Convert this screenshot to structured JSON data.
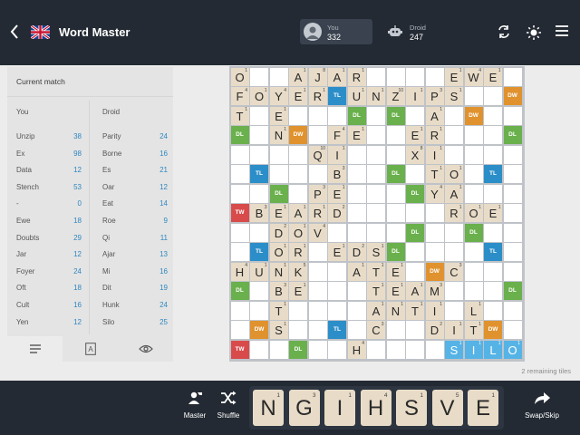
{
  "header": {
    "title": "Word Master",
    "you": {
      "name": "You",
      "score": "332"
    },
    "droid": {
      "name": "Droid",
      "score": "247"
    },
    "icons": [
      "back-icon",
      "uk-flag-icon",
      "swap-icon",
      "brightness-icon",
      "menu-icon"
    ]
  },
  "panel": {
    "title": "Current match",
    "col_you": "You",
    "col_droid": "Droid",
    "you_words": [
      {
        "w": "Unzip",
        "s": "38"
      },
      {
        "w": "Ex",
        "s": "98"
      },
      {
        "w": "Data",
        "s": "12"
      },
      {
        "w": "Stench",
        "s": "53"
      },
      {
        "w": "-",
        "s": "0"
      },
      {
        "w": "Ewe",
        "s": "18"
      },
      {
        "w": "Doubts",
        "s": "29"
      },
      {
        "w": "Jar",
        "s": "12"
      },
      {
        "w": "Foyer",
        "s": "24"
      },
      {
        "w": "Oft",
        "s": "18"
      },
      {
        "w": "Cult",
        "s": "16"
      },
      {
        "w": "Yen",
        "s": "12"
      }
    ],
    "droid_words": [
      {
        "w": "Parity",
        "s": "24"
      },
      {
        "w": "Borne",
        "s": "16"
      },
      {
        "w": "Es",
        "s": "21"
      },
      {
        "w": "Oar",
        "s": "12"
      },
      {
        "w": "Eat",
        "s": "14"
      },
      {
        "w": "Roe",
        "s": "9"
      },
      {
        "w": "Qi",
        "s": "11"
      },
      {
        "w": "Ajar",
        "s": "13"
      },
      {
        "w": "Mi",
        "s": "16"
      },
      {
        "w": "Dit",
        "s": "19"
      },
      {
        "w": "Hunk",
        "s": "24"
      },
      {
        "w": "Silo",
        "s": "25"
      }
    ],
    "tabs": [
      "list-icon",
      "letter-a-icon",
      "eye-icon"
    ]
  },
  "board": {
    "bonus_labels": {
      "DL": "DL",
      "TL": "TL",
      "DW": "DW",
      "TW": "TW"
    },
    "premium": {
      "3,0": "DL",
      "11,0": "DL",
      "5,1": "TL",
      "14,1": "DW",
      "6,2": "DL",
      "8,2": "DL",
      "12,2": "DW",
      "0,3": "DL",
      "3,3": "DW",
      "14,3": "DL",
      "4,4": "DW",
      "1,5": "TL",
      "8,5": "DL",
      "13,5": "TL",
      "2,6": "DL",
      "9,6": "DL",
      "0,7": "TW",
      "11,7": "TL",
      "9,8": "DL",
      "12,8": "DL",
      "1,9": "TL",
      "8,9": "DL",
      "13,9": "TL",
      "10,10": "DW",
      "0,11": "DL",
      "14,11": "DL",
      "12,12": "DW",
      "1,13": "DW",
      "5,13": "TL",
      "13,13": "DW",
      "0,14": "TW",
      "3,14": "DL"
    },
    "rows": [
      "O..AJAR....EWE",
      "FOYER.UNZIPS..",
      "T.E.......A...",
      "..N..FE..ER...",
      "....QI...XI...",
      ".....B....TO..",
      "....PE....YA..",
      ".BEARD.....ROE",
      "..DOV.........",
      "..OR.EDS......",
      "HUNK..ATE..C..",
      "..BE...TEAM...",
      "..T....ANTI.L.",
      "..S....C..DIT.",
      "......H....SILO"
    ],
    "highlight_row": 14,
    "highlight_cols": [
      11,
      12,
      13,
      14
    ],
    "values": {
      "A": 1,
      "B": 3,
      "C": 3,
      "D": 2,
      "E": 1,
      "F": 4,
      "G": 2,
      "H": 4,
      "I": 1,
      "J": 8,
      "K": 5,
      "L": 1,
      "M": 3,
      "N": 1,
      "O": 1,
      "P": 3,
      "Q": 10,
      "R": 1,
      "S": 1,
      "T": 1,
      "U": 1,
      "V": 4,
      "W": 4,
      "X": 8,
      "Y": 4,
      "Z": 10
    }
  },
  "remaining": "2 remaining tiles",
  "footer": {
    "master_label": "Master",
    "shuffle_label": "Shuffle",
    "swap_label": "Swap/Skip",
    "rack": [
      {
        "l": "N",
        "p": "1"
      },
      {
        "l": "G",
        "p": "3"
      },
      {
        "l": "I",
        "p": "1"
      },
      {
        "l": "H",
        "p": "4"
      },
      {
        "l": "S",
        "p": "1"
      },
      {
        "l": "V",
        "p": "5"
      },
      {
        "l": "E",
        "p": "1"
      }
    ]
  },
  "colors": {
    "DL": "#6ab04c",
    "TL": "#2c8ec8",
    "DW": "#e0922e",
    "TW": "#d94b4b",
    "tile": "#e8dcc8",
    "highlight": "#56b3e6",
    "bar": "#232a33"
  }
}
